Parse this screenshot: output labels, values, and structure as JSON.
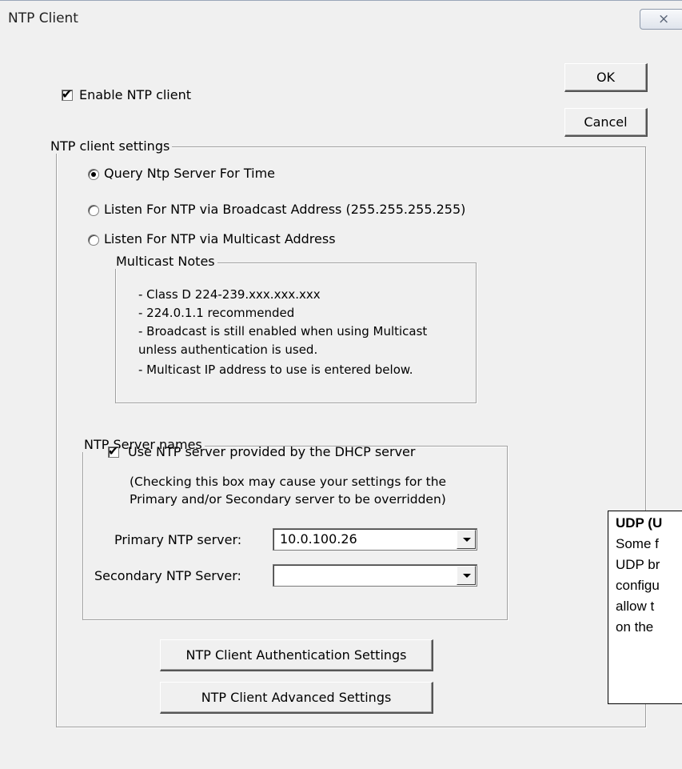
{
  "window": {
    "title": "NTP Client",
    "close_glyph": "⨯"
  },
  "buttons": {
    "ok": "OK",
    "cancel": "Cancel",
    "auth": "NTP Client Authentication Settings",
    "advanced": "NTP Client Advanced Settings"
  },
  "enable": {
    "label": "Enable NTP client",
    "checked": true
  },
  "settings_group": {
    "legend": "NTP client settings",
    "radios": [
      {
        "label": "Query Ntp Server For Time",
        "selected": true
      },
      {
        "label": "Listen For NTP via Broadcast Address (255.255.255.255)",
        "selected": false
      },
      {
        "label": "Listen For NTP via Multicast Address",
        "selected": false
      }
    ]
  },
  "multicast_notes": {
    "legend": "Multicast Notes",
    "lines": [
      "- Class D 224-239.xxx.xxx.xxx",
      "- 224.0.1.1 recommended",
      "- Broadcast is still enabled when using Multicast",
      "  unless authentication is used.",
      "- Multicast IP address to use is entered below."
    ]
  },
  "server_names": {
    "legend": "NTP Server names",
    "dhcp_label": "Use NTP server provided by the DHCP server",
    "dhcp_checked": true,
    "note_line1": "(Checking this box may cause your settings for the",
    "note_line2": "Primary and/or Secondary server to be overridden)",
    "primary_label": "Primary NTP server:",
    "primary_value": "10.0.100.26",
    "secondary_label": "Secondary NTP Server:",
    "secondary_value": ""
  },
  "callout": {
    "heading": "UDP (U",
    "lines": [
      "Some f",
      "UDP br",
      "configu",
      "allow t",
      "on the"
    ]
  },
  "colors": {
    "dialog_bg": "#f0f0f0",
    "group_border": "#a0a0a0"
  },
  "icons": {
    "check": "checkmark-icon",
    "dropdown": "chevron-down-icon"
  }
}
